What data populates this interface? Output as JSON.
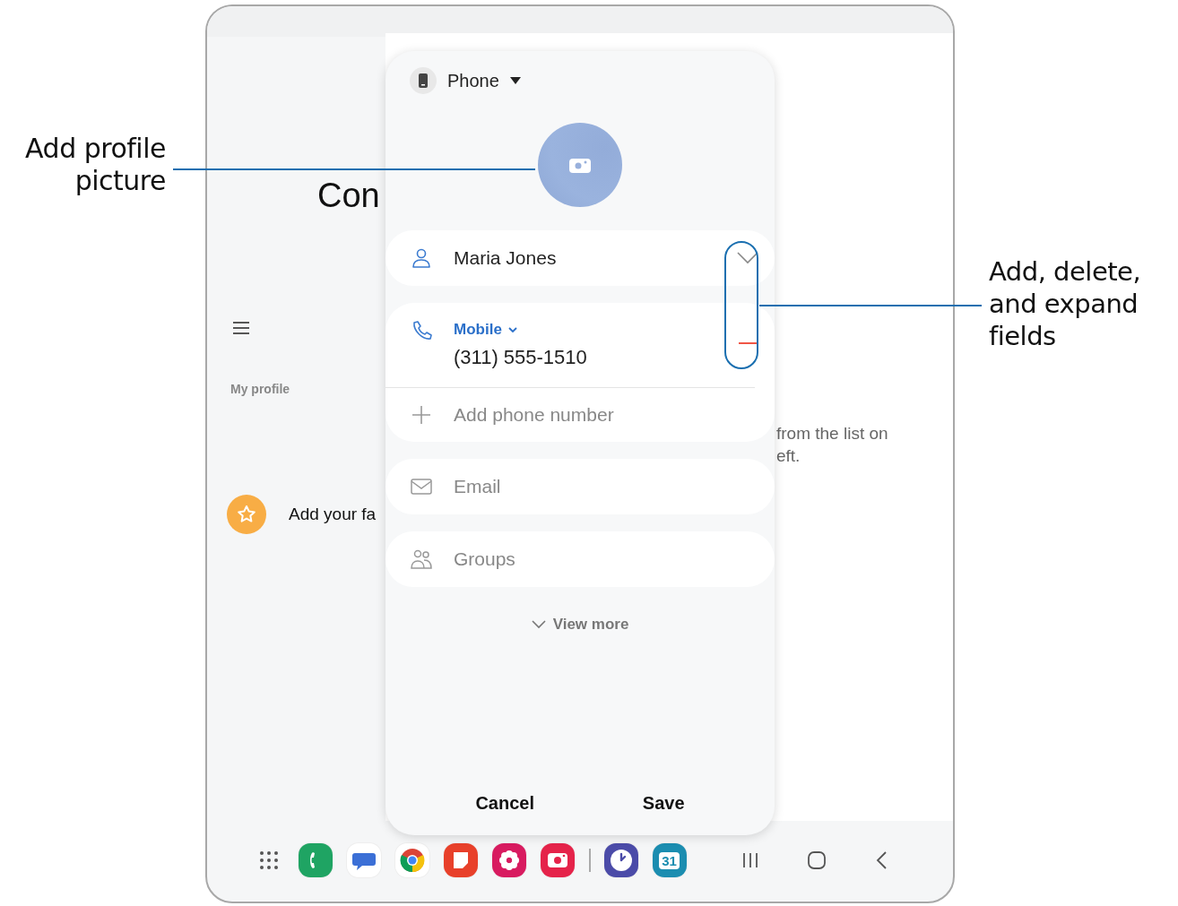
{
  "callouts": {
    "left": "Add profile\npicture",
    "right": "Add, delete,\nand expand\nfields"
  },
  "background": {
    "title": "Con",
    "section_label": "My profile",
    "favorites_text": "Add your fa",
    "hint": "from the list on\neft."
  },
  "dialog": {
    "storage": "Phone",
    "fields": [
      {
        "kind": "name",
        "value": "Maria Jones"
      },
      {
        "kind": "phone",
        "type_label": "Mobile",
        "value": "(311) 555-1510"
      },
      {
        "kind": "add",
        "placeholder": "Add phone number"
      },
      {
        "kind": "email",
        "placeholder": "Email"
      },
      {
        "kind": "groups",
        "placeholder": "Groups"
      }
    ],
    "view_more": "View more",
    "buttons": [
      "Cancel",
      "Save"
    ]
  },
  "dock": {
    "apps": [
      {
        "kind": "grid"
      },
      {
        "kind": "phone",
        "color": "#1fa463"
      },
      {
        "kind": "messages",
        "color": "#ffffff"
      },
      {
        "kind": "browser",
        "color": "#ffffff"
      },
      {
        "kind": "notes",
        "color": "#e8402a"
      },
      {
        "kind": "flower",
        "color": "#d81b60"
      },
      {
        "kind": "camera",
        "color": "#e5234a"
      },
      {
        "kind": "divider"
      },
      {
        "kind": "clock",
        "color": "#4b4ba8"
      },
      {
        "kind": "calendar",
        "color": "#1b8db0",
        "text": "31"
      }
    ],
    "nav": [
      {
        "kind": "recents"
      },
      {
        "kind": "home"
      },
      {
        "kind": "back"
      }
    ]
  }
}
